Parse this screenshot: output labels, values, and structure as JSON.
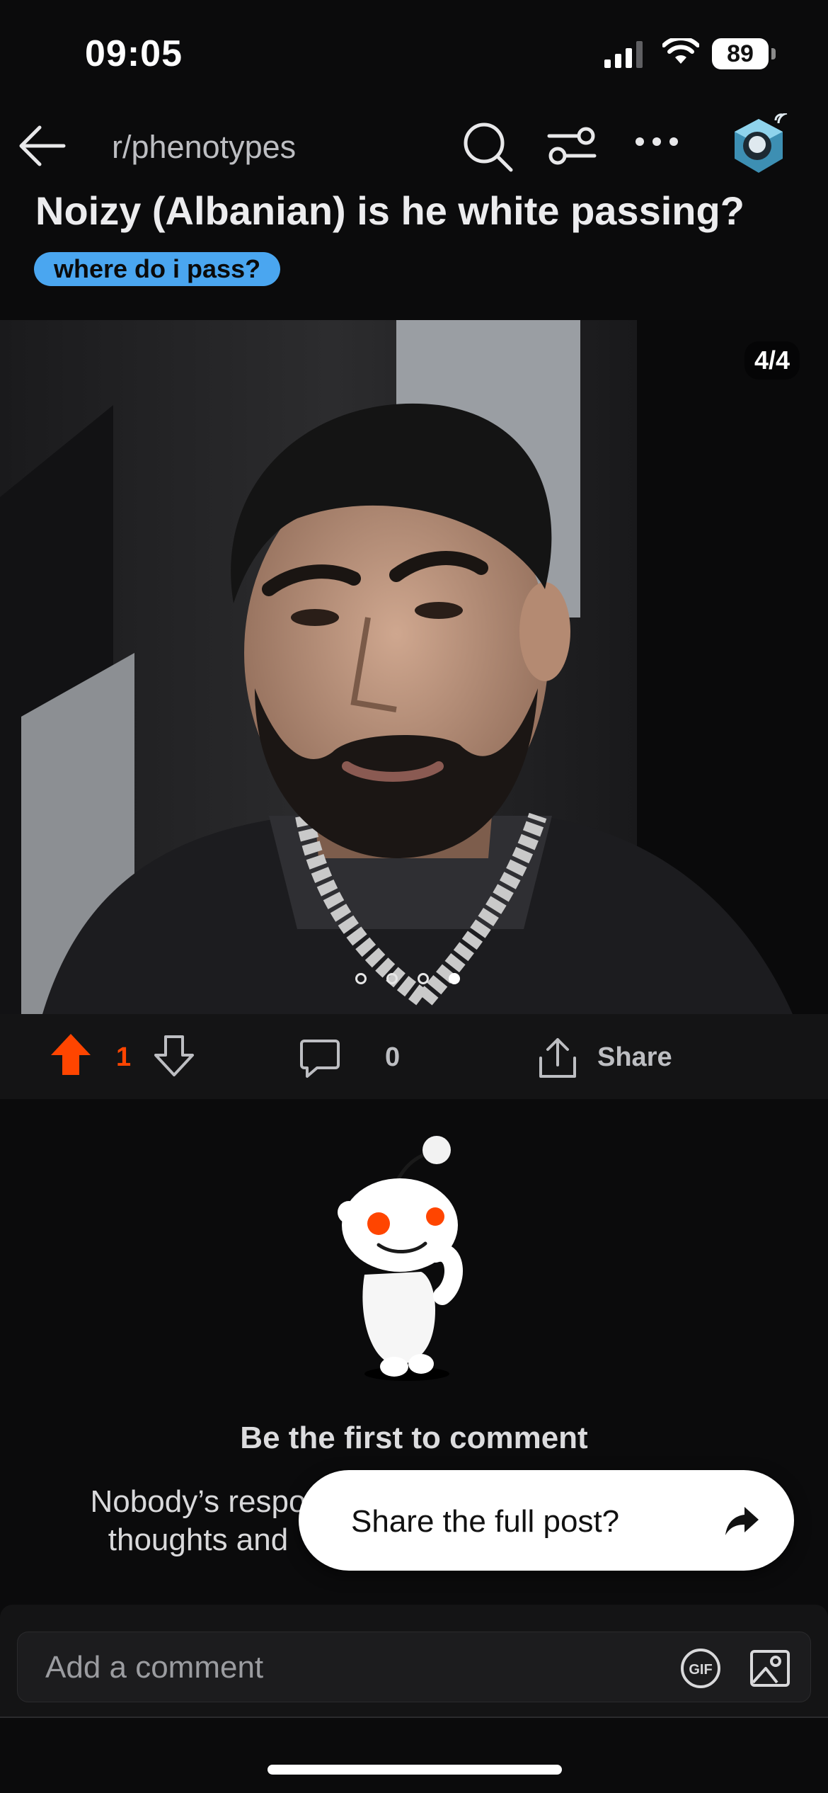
{
  "status_bar": {
    "time": "09:05",
    "battery": "89"
  },
  "header": {
    "subreddit": "r/phenotypes",
    "icons": [
      "back-arrow-icon",
      "search-icon",
      "filter-icon",
      "more-icon",
      "avatar"
    ]
  },
  "post": {
    "title": "Noizy (Albanian) is he white passing?",
    "flair": "where do i pass?",
    "image_counter": "4/4",
    "gallery": {
      "total": 4,
      "current": 4
    }
  },
  "actions": {
    "upvotes": "1",
    "comments": "0",
    "share_label": "Share",
    "colors": {
      "upvote_active": "#ff4500"
    }
  },
  "empty_state": {
    "title": "Be the first to comment",
    "subtitle": "Nobody’s respo thoughts and"
  },
  "share_popup": {
    "label": "Share the full post?"
  },
  "composer": {
    "placeholder": "Add a comment",
    "gif_label": "GIF"
  }
}
